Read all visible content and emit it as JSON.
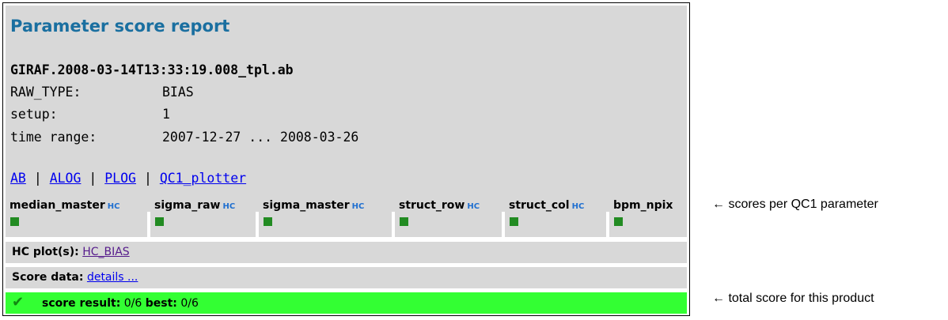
{
  "title": "Parameter score report",
  "file": "GIRAF.2008-03-14T13:33:19.008_tpl.ab",
  "fields": [
    {
      "key": "RAW_TYPE:",
      "value": "BIAS"
    },
    {
      "key": "setup:",
      "value": "1"
    },
    {
      "key": "time range:",
      "value": "2007-12-27 ... 2008-03-26"
    }
  ],
  "links": [
    "AB",
    "ALOG",
    "PLOG",
    "QC1_plotter"
  ],
  "link_separator": "|",
  "parameters": [
    {
      "name": "median_master",
      "hc": "HC",
      "score_color": "#228b22"
    },
    {
      "name": "sigma_raw",
      "hc": "HC",
      "score_color": "#228b22"
    },
    {
      "name": "sigma_master",
      "hc": "HC",
      "score_color": "#228b22"
    },
    {
      "name": "struct_row",
      "hc": "HC",
      "score_color": "#228b22"
    },
    {
      "name": "struct_col",
      "hc": "HC",
      "score_color": "#228b22"
    },
    {
      "name": "bpm_npix",
      "hc": "",
      "score_color": "#228b22"
    }
  ],
  "hc_plots": {
    "label": "HC plot(s):",
    "link": "HC_BIAS"
  },
  "score_data": {
    "label": "Score data:",
    "link": "details ..."
  },
  "result": {
    "icon": "checkmark-icon",
    "score_label": "score result:",
    "score_value": "0/6",
    "best_label": "best:",
    "best_value": "0/6",
    "color": "#33ff33"
  },
  "annotations": {
    "params": "← scores per QC1 parameter",
    "total": "← total score for this product"
  }
}
